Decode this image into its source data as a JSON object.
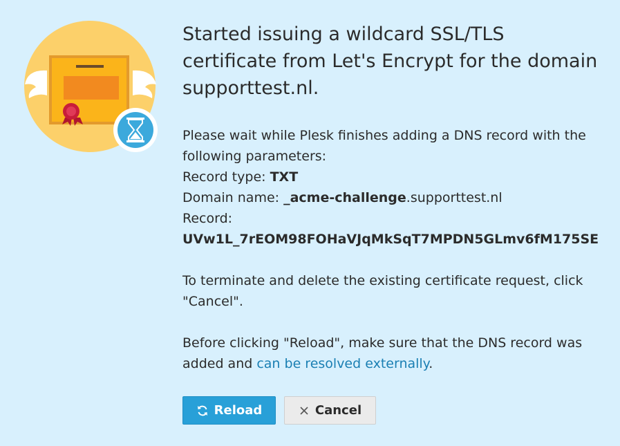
{
  "dialog": {
    "title": "Started issuing a wildcard SSL/TLS certificate from Let's Encrypt for the domain supporttest.nl.",
    "intro": "Please wait while Plesk finishes adding a DNS record with the following parameters:",
    "record_type_label": "Record type: ",
    "record_type_value": "TXT",
    "domain_name_label": "Domain name: ",
    "domain_name_bold": "_acme-challenge",
    "domain_name_rest": ".supporttest.nl",
    "record_label": "Record:",
    "record_value": "UVw1L_7rEOM98FOHaVJqMkSqT7MPDN5GLmv6fM175SE",
    "terminate_text": "To terminate and delete the existing certificate request, click \"Cancel\".",
    "reload_text_before": "Before clicking \"Reload\", make sure that the DNS record was added and ",
    "reload_link": "can be resolved externally",
    "reload_text_after": "."
  },
  "buttons": {
    "reload_label": "Reload",
    "cancel_label": "Cancel"
  },
  "icons": {
    "illustration": "certificate-with-wings-icon",
    "badge": "hourglass-icon",
    "reload": "refresh-icon",
    "cancel": "close-icon"
  },
  "colors": {
    "panel_bg": "#d8f0fd",
    "primary": "#28a0d8",
    "link": "#1a7fb3"
  }
}
